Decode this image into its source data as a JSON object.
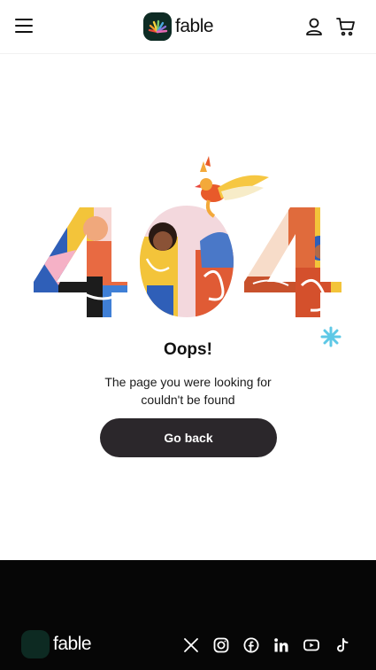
{
  "header": {
    "brand": "fable"
  },
  "error": {
    "code": "404",
    "heading": "Oops!",
    "message": "The page you were looking for couldn't be found",
    "button_label": "Go back"
  },
  "footer": {
    "brand": "fable",
    "social_icons": [
      "x-icon",
      "instagram-icon",
      "facebook-icon",
      "linkedin-icon",
      "youtube-icon",
      "tiktok-icon"
    ]
  },
  "colors": {
    "button_bg": "#2b272b",
    "footer_bg": "#060606",
    "logo_bg": "#0e2b24",
    "accent_blue": "#5ec8e6"
  }
}
